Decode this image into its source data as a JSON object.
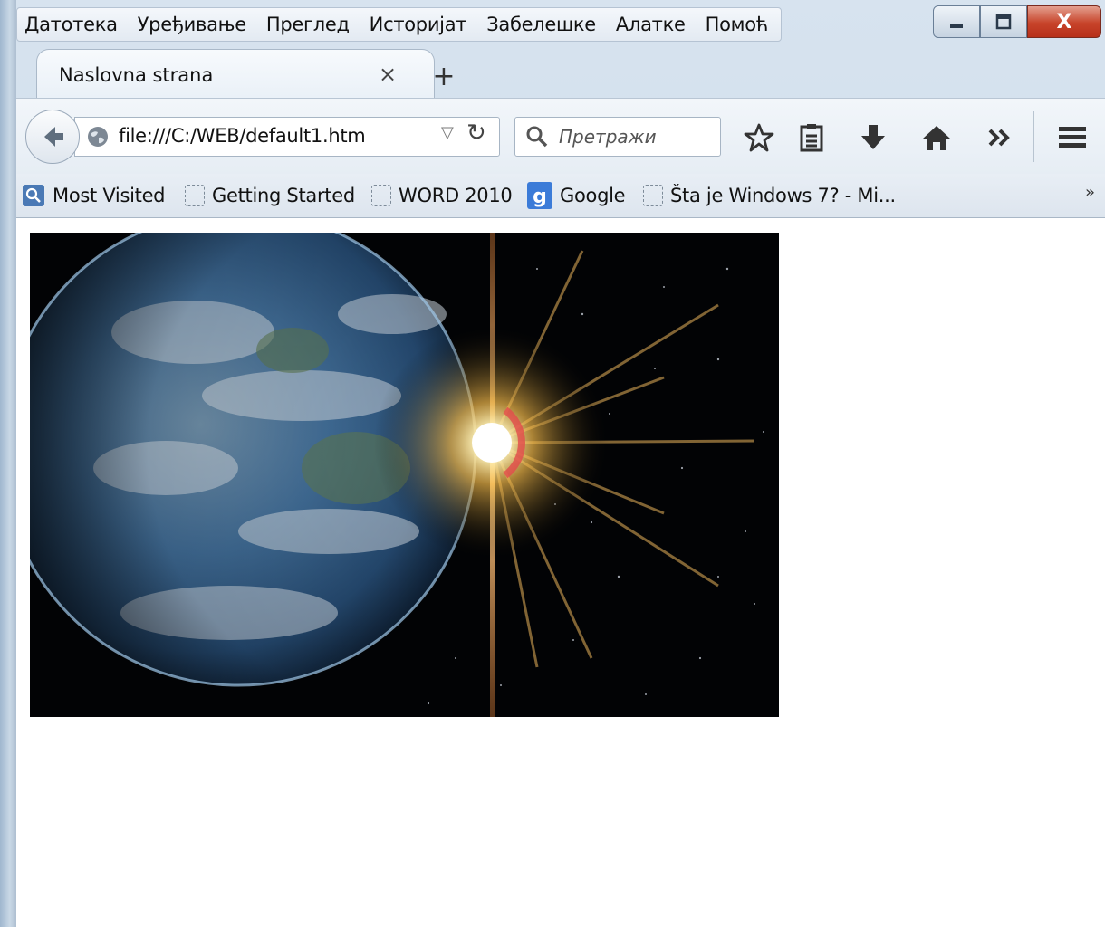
{
  "menu": {
    "items": [
      "Датотека",
      "Уређивање",
      "Преглед",
      "Историјат",
      "Забелешке",
      "Алатке",
      "Помоћ"
    ]
  },
  "tab": {
    "title": "Naslovna strana"
  },
  "navigation": {
    "url": "file:///C:/WEB/default1.htm",
    "search_placeholder": "Претражи"
  },
  "bookmarks": {
    "items": [
      "Most Visited",
      "Getting Started",
      "WORD 2010",
      "Google",
      "Šta je Windows 7? - Mi..."
    ],
    "overflow": "»"
  },
  "window": {
    "close_glyph": "X"
  },
  "colors": {
    "close_button": "#c7432a",
    "google_badge": "#3b7bd8"
  },
  "content": {
    "image_description_icon": "earth-sunrise-image"
  }
}
